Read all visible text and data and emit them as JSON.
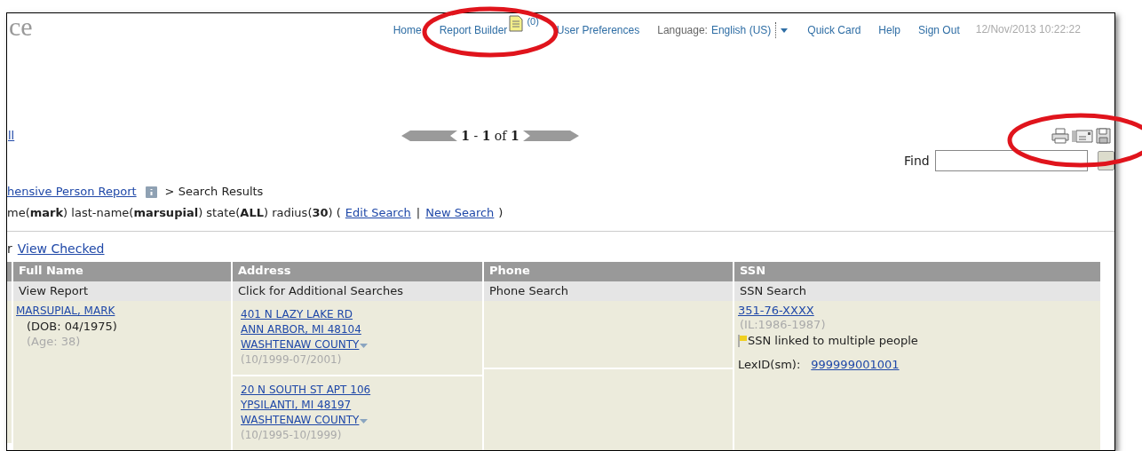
{
  "header": {
    "logo_fragment": "ce",
    "links": [
      {
        "kind": "link",
        "label": "Home"
      },
      {
        "kind": "report",
        "label": "Report Builder",
        "count": "(0)"
      },
      {
        "kind": "link",
        "label": "User Preferences"
      },
      {
        "kind": "language",
        "label": "Language:",
        "value": "English (US)"
      },
      {
        "kind": "link",
        "label": "Quick Card"
      },
      {
        "kind": "link",
        "label": "Help"
      },
      {
        "kind": "link",
        "label": "Sign Out"
      }
    ],
    "timestamp": "12/Nov/2013 10:22:22"
  },
  "pager": {
    "left_link": "ll",
    "text": "**1** - **1** of **1**"
  },
  "find": {
    "label": "Find"
  },
  "breadcrumb": {
    "link": "hensive Person Report",
    "current": "> Search Results"
  },
  "criteria": {
    "text": "me(**mark**) last-name(**marsupial**) state(**ALL**) radius(**30**) (",
    "links": [
      "Edit Search",
      "New Search"
    ],
    "separator": "|",
    "close": ")"
  },
  "view_checked": {
    "prefix": "r",
    "link": "View Checked"
  },
  "table": {
    "columns": [
      "Full Name",
      "Address",
      "Phone",
      "SSN"
    ],
    "subheaders": [
      "View Report",
      "Click for Additional Searches",
      "Phone Search",
      "SSN Search"
    ],
    "rows": [
      {
        "name": "MARSUPIAL, MARK",
        "dob": "(DOB: 04/1975)",
        "age": "(Age: 38)",
        "addresses": [
          {
            "lines": [
              "401 N LAZY LAKE RD",
              "ANN ARBOR, MI 48104"
            ],
            "county": "WASHTENAW COUNTY",
            "dates": "(10/1999-07/2001)"
          },
          {
            "lines": [
              "20 N SOUTH ST APT 106",
              "YPSILANTI, MI 48197"
            ],
            "county": "WASHTENAW COUNTY",
            "dates": "(10/1995-10/1999)"
          }
        ],
        "ssn": "351-76-XXXX",
        "ssn_issued": "(IL:1986-1987)",
        "ssn_flag": "SSN linked to multiple people",
        "lexid_label": "LexID(sm):",
        "lexid": "999999001001"
      }
    ]
  }
}
